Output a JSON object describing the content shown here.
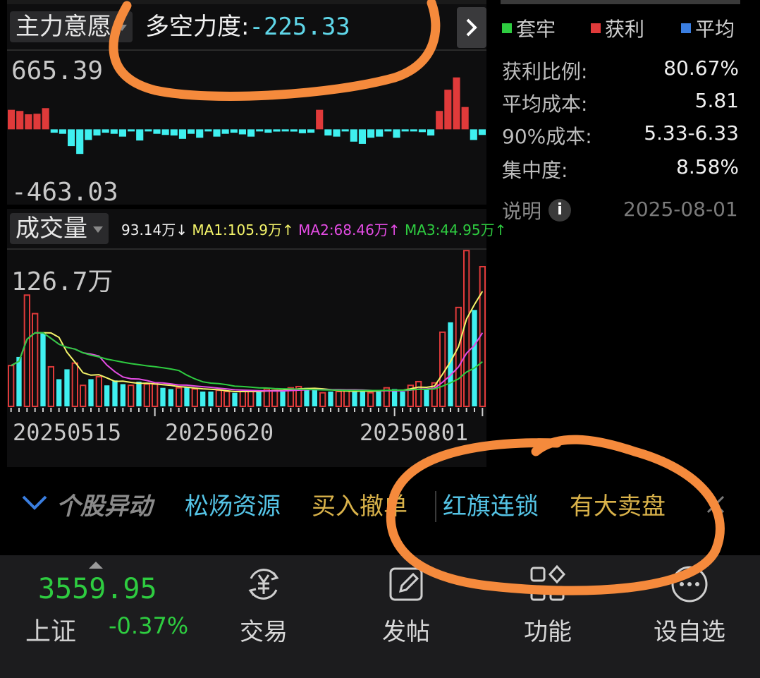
{
  "indicator": {
    "selector_label": "主力意愿",
    "duokong_label": "多空力度:",
    "duokong_value": "-225.33",
    "max_value": "665.39",
    "min_value": "-463.03"
  },
  "volume": {
    "selector_label": "成交量",
    "current": "93.14万↓",
    "ma1": "MA1:105.9万↑",
    "ma2": "MA2:68.46万↑",
    "ma3": "MA3:44.95万↑",
    "max_label": "126.7万"
  },
  "dates": [
    "20250515",
    "20250620",
    "20250801"
  ],
  "chips": {
    "legend": [
      "套牢",
      "获利",
      "平均"
    ],
    "rows": [
      {
        "label": "获利比例:",
        "value": "80.67%"
      },
      {
        "label": "平均成本:",
        "value": "5.81"
      },
      {
        "label": "90%成本:",
        "value": "5.33-6.33"
      },
      {
        "label": "集中度:",
        "value": "8.58%"
      }
    ],
    "note_label": "说明",
    "note_date": "2025-08-01"
  },
  "ticker": {
    "title": "个股异动",
    "items": [
      {
        "stock": "松炀资源",
        "event": "买入撤单"
      },
      {
        "stock": "红旗连锁",
        "event": "有大卖盘"
      }
    ]
  },
  "index": {
    "value": "3559.95",
    "name": "上证",
    "change": "-0.37%"
  },
  "nav": [
    {
      "label": "交易",
      "icon": "trade-yen-icon"
    },
    {
      "label": "发帖",
      "icon": "post-edit-icon"
    },
    {
      "label": "功能",
      "icon": "function-grid-icon"
    },
    {
      "label": "设自选",
      "icon": "more-dots-icon"
    }
  ],
  "colors": {
    "up": "#e03a3a",
    "down": "#3ff0f0",
    "green": "#2ecc40",
    "orange": "#f58a3c",
    "yellow": "#f5f56a",
    "magenta": "#e54ce5",
    "accent_blue": "#55c4e6",
    "gold": "#d9b24a"
  },
  "chart_data": [
    {
      "type": "bar",
      "title": "主力意愿",
      "ylim": [
        -463.03,
        665.39
      ],
      "values": [
        175,
        165,
        135,
        140,
        190,
        -30,
        -40,
        -150,
        -220,
        -95,
        -55,
        -30,
        -40,
        -65,
        -10,
        -100,
        -10,
        -40,
        -50,
        -55,
        -85,
        -40,
        -75,
        -10,
        -65,
        -40,
        -30,
        -45,
        -65,
        -10,
        -30,
        -20,
        -15,
        -20,
        -35,
        -30,
        175,
        -55,
        -65,
        -10,
        -110,
        -130,
        -75,
        -65,
        -10,
        -75,
        -15,
        -10,
        -25,
        -55,
        165,
        355,
        465,
        200,
        -95,
        -50
      ],
      "values_note_ignored": false
    },
    {
      "type": "bar",
      "title": "成交量",
      "ylim": [
        0,
        126.7
      ],
      "categories": [
        "20250515",
        "20250620",
        "20250801"
      ],
      "values": [
        33,
        40,
        90,
        75,
        60,
        32,
        22,
        30,
        35,
        17,
        22,
        24,
        17,
        21,
        18,
        17,
        20,
        18,
        18,
        15,
        14,
        15,
        16,
        14,
        12,
        12,
        13,
        12,
        11,
        12,
        12,
        13,
        14,
        13,
        13,
        15,
        16,
        15,
        14,
        11,
        12,
        12,
        13,
        13,
        12,
        11,
        13,
        15,
        14,
        12,
        17,
        20,
        14,
        19,
        60,
        68,
        80,
        126,
        78,
        113
      ]
    }
  ]
}
